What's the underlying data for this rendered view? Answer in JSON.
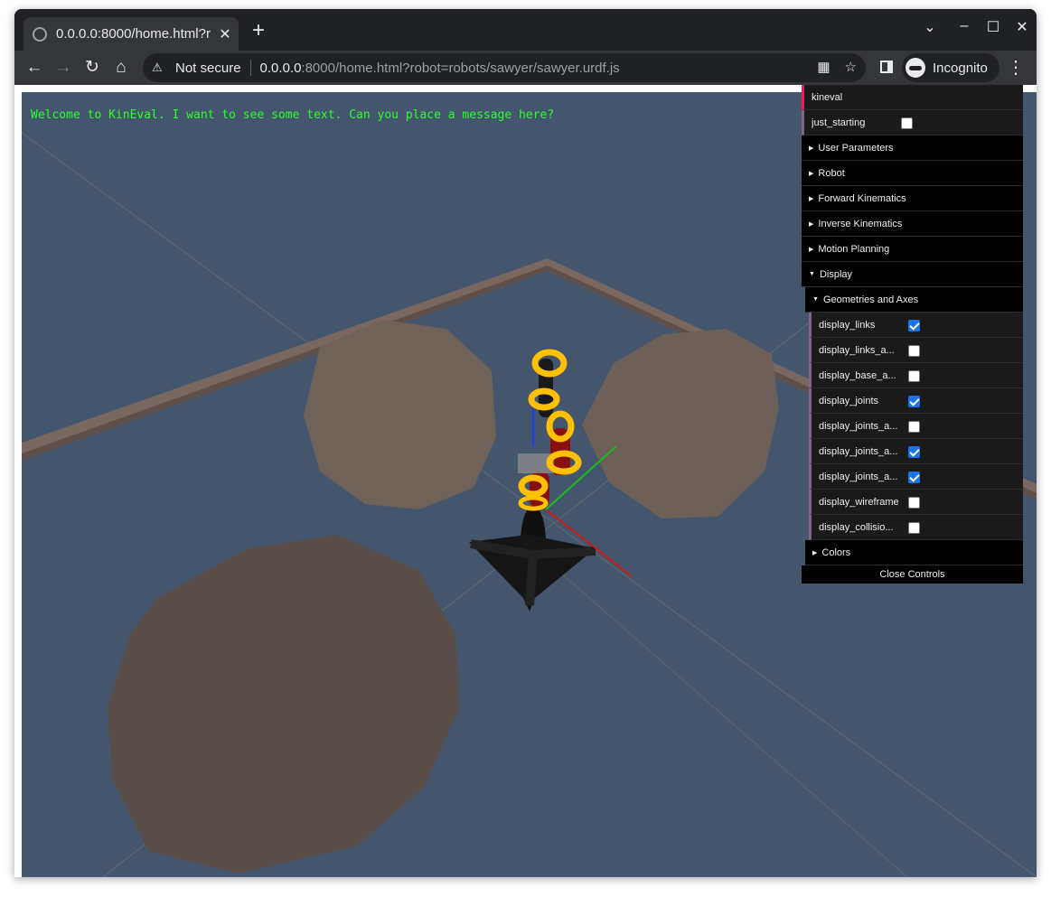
{
  "browser": {
    "tab_title": "0.0.0.0:8000/home.html?r",
    "new_tab": "+",
    "security_label": "Not secure",
    "url_host": "0.0.0.0",
    "url_path": ":8000/home.html?robot=robots/sawyer/sawyer.urdf.js",
    "profile_label": "Incognito"
  },
  "scene": {
    "message": "Welcome to KinEval. I want to see some text. Can you place a message here?"
  },
  "gui": {
    "title": "kineval",
    "just_starting": {
      "label": "just_starting",
      "checked": false
    },
    "folders": [
      {
        "label": "User Parameters"
      },
      {
        "label": "Robot"
      },
      {
        "label": "Forward Kinematics"
      },
      {
        "label": "Inverse Kinematics"
      },
      {
        "label": "Motion Planning"
      }
    ],
    "display": {
      "label": "Display",
      "geometries": {
        "label": "Geometries and Axes",
        "items": [
          {
            "label": "display_links",
            "checked": true
          },
          {
            "label": "display_links_a...",
            "checked": false
          },
          {
            "label": "display_base_a...",
            "checked": false
          },
          {
            "label": "display_joints",
            "checked": true
          },
          {
            "label": "display_joints_a...",
            "checked": false
          },
          {
            "label": "display_joints_a...",
            "checked": true
          },
          {
            "label": "display_joints_a...",
            "checked": true
          },
          {
            "label": "display_wireframe",
            "checked": false
          },
          {
            "label": "display_collisio...",
            "checked": false
          }
        ]
      },
      "colors": {
        "label": "Colors"
      }
    },
    "close_label": "Close Controls"
  }
}
